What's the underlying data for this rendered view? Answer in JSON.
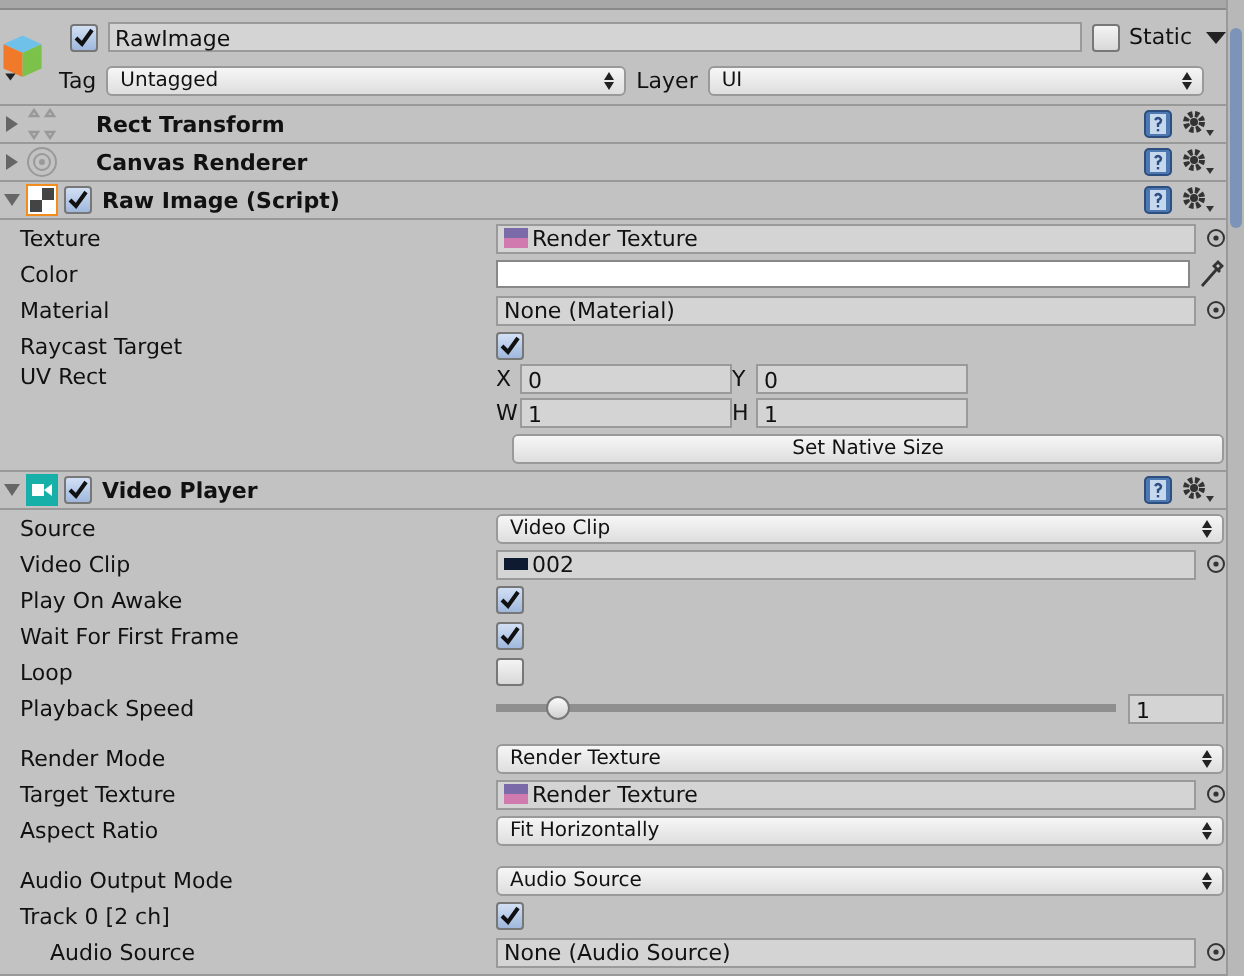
{
  "header": {
    "active": true,
    "name": "RawImage",
    "static": false,
    "static_label": "Static",
    "tag_label": "Tag",
    "tag": "Untagged",
    "layer_label": "Layer",
    "layer": "UI"
  },
  "components": [
    {
      "title": "Rect Transform",
      "kind": "rect",
      "expanded": false
    },
    {
      "title": "Canvas Renderer",
      "kind": "canvas",
      "expanded": false
    },
    {
      "title": "Raw Image (Script)",
      "kind": "rawimage",
      "expanded": true,
      "enabled": true,
      "fields": [
        {
          "kind": "texture_object",
          "label": "Texture",
          "value": "Render Texture"
        },
        {
          "kind": "color",
          "label": "Color",
          "color": "#ffffff"
        },
        {
          "kind": "object",
          "label": "Material",
          "value": "None (Material)"
        },
        {
          "kind": "checkbox",
          "label": "Raycast Target",
          "checked": true
        },
        {
          "kind": "rect4",
          "label": "UV Rect",
          "parts": [
            {
              "label": "X",
              "value": "0"
            },
            {
              "label": "Y",
              "value": "0"
            },
            {
              "label": "W",
              "value": "1"
            },
            {
              "label": "H",
              "value": "1"
            }
          ]
        },
        {
          "kind": "button",
          "value": "Set Native Size"
        }
      ]
    },
    {
      "title": "Video Player",
      "kind": "video",
      "expanded": true,
      "enabled": true,
      "fields": [
        {
          "kind": "dropdown",
          "label": "Source",
          "value": "Video Clip"
        },
        {
          "kind": "clip_object",
          "label": "Video Clip",
          "value": "002"
        },
        {
          "kind": "checkbox",
          "label": "Play On Awake",
          "checked": true
        },
        {
          "kind": "checkbox",
          "label": "Wait For First Frame",
          "checked": true
        },
        {
          "kind": "checkbox",
          "label": "Loop",
          "checked": false
        },
        {
          "kind": "slider",
          "label": "Playback Speed",
          "level": 0.1,
          "value": "1"
        },
        {
          "kind": "dropdown",
          "label": "Render Mode",
          "value": "Render Texture",
          "gap_before": true
        },
        {
          "kind": "texture_object",
          "label": "Target Texture",
          "value": "Render Texture"
        },
        {
          "kind": "dropdown",
          "label": "Aspect Ratio",
          "value": "Fit Horizontally"
        },
        {
          "kind": "dropdown",
          "label": "Audio Output Mode",
          "value": "Audio Source",
          "gap_before": true
        },
        {
          "kind": "checkbox",
          "label": "Track 0 [2 ch]",
          "checked": true,
          "children": [
            {
              "kind": "object",
              "label": "Audio Source",
              "value": "None (Audio Source)"
            }
          ]
        }
      ]
    }
  ]
}
